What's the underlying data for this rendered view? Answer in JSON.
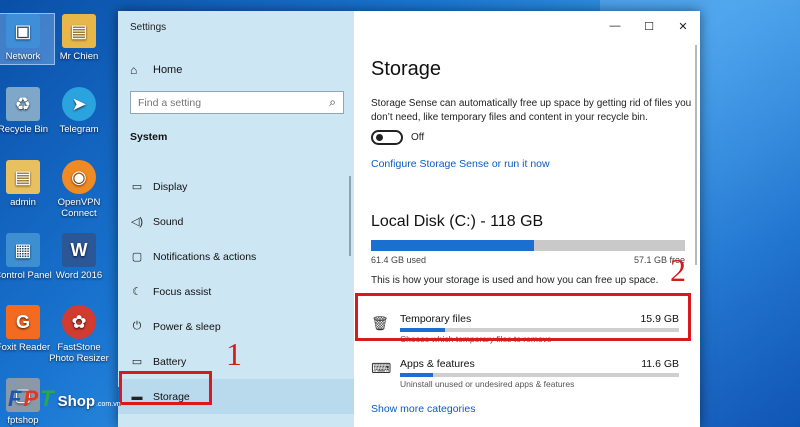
{
  "desktop": {
    "icons": [
      {
        "label": "Network",
        "icon": "network-icon",
        "color": "#3f8fd8",
        "glyph": "▣"
      },
      {
        "label": "Mr Chien",
        "icon": "user-folder-icon",
        "color": "#e8b74a",
        "glyph": "▤"
      },
      {
        "label": "Recycle Bin",
        "icon": "recycle-bin-icon",
        "color": "#7fa7c8",
        "glyph": "♻"
      },
      {
        "label": "Telegram",
        "icon": "telegram-icon",
        "color": "#2aa3de",
        "glyph": "➤"
      },
      {
        "label": "admin",
        "icon": "user-folder-icon",
        "color": "#e8c060",
        "glyph": "▤"
      },
      {
        "label": "OpenVPN Connect",
        "icon": "openvpn-icon",
        "color": "#f08a24",
        "glyph": "◉"
      },
      {
        "label": "Control Panel",
        "icon": "control-panel-icon",
        "color": "#3d8fd1",
        "glyph": "▦"
      },
      {
        "label": "Word 2016",
        "icon": "word-icon",
        "color": "#2b5797",
        "glyph": "W"
      },
      {
        "label": "Foxit Reader",
        "icon": "foxit-reader-icon",
        "color": "#f26b21",
        "glyph": "G"
      },
      {
        "label": "FastStone Photo Resizer",
        "icon": "faststone-icon",
        "color": "#d23b2f",
        "glyph": "✿"
      },
      {
        "label": "fptshop",
        "icon": "shortcut-icon",
        "color": "#8a99a8",
        "glyph": "▢"
      }
    ]
  },
  "window": {
    "app_title": "Settings",
    "controls": {
      "minimize": "—",
      "maximize": "☐",
      "close": "✕"
    }
  },
  "nav": {
    "home_label": "Home",
    "search_placeholder": "Find a setting",
    "section_title": "System",
    "items": [
      {
        "label": "Display",
        "icon": "display-icon",
        "glyph": "▭"
      },
      {
        "label": "Sound",
        "icon": "sound-icon",
        "glyph": "🔈"
      },
      {
        "label": "Notifications & actions",
        "icon": "notifications-icon",
        "glyph": "▢"
      },
      {
        "label": "Focus assist",
        "icon": "focus-assist-icon",
        "glyph": "☾"
      },
      {
        "label": "Power & sleep",
        "icon": "power-icon",
        "glyph": "⏻"
      },
      {
        "label": "Battery",
        "icon": "battery-icon",
        "glyph": "▭"
      },
      {
        "label": "Storage",
        "icon": "storage-icon",
        "glyph": "▬"
      }
    ],
    "active": "Storage"
  },
  "content": {
    "title": "Storage",
    "sense_description": "Storage Sense can automatically free up space by getting rid of files you don’t need, like temporary files and content in your recycle bin.",
    "toggle_state": "Off",
    "configure_link": "Configure Storage Sense or run it now",
    "disk": {
      "title": "Local Disk (C:) - 118 GB",
      "used_label": "61.4 GB used",
      "free_label": "57.1 GB free",
      "used_fraction": 0.52
    },
    "usage_description": "This is how your storage is used and how you can free up space.",
    "categories": [
      {
        "name": "Temporary files",
        "size": "15.9 GB",
        "sub": "Choose which temporary files to remove",
        "icon": "trash-icon",
        "glyph": "🗑",
        "fraction": 0.16
      },
      {
        "name": "Apps & features",
        "size": "11.6 GB",
        "sub": "Uninstall unused or undesired apps & features",
        "icon": "keyboard-icon",
        "glyph": "⌨",
        "fraction": 0.12
      }
    ],
    "show_more_link": "Show more categories"
  },
  "annotations": {
    "marker_1": "1",
    "marker_2": "2",
    "color": "#d8191d"
  },
  "watermark": {
    "letters": [
      "F",
      "P",
      "T"
    ],
    "colors": [
      "#1a56b8",
      "#e53526",
      "#2aa84a"
    ],
    "shop": "Shop",
    "domain": ".com.vn"
  }
}
